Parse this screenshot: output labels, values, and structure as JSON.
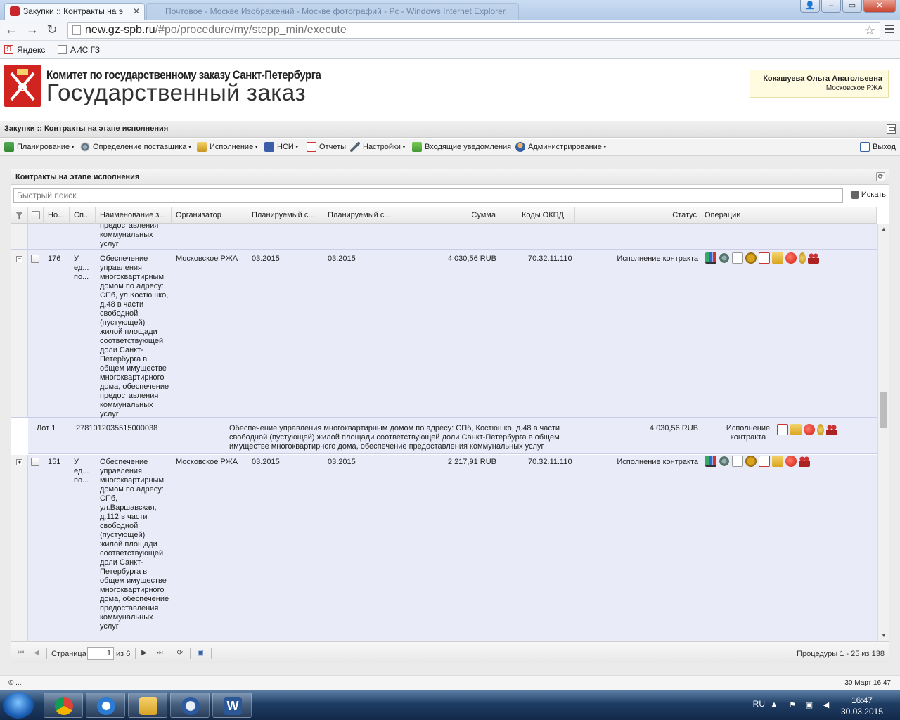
{
  "browser": {
    "active_tab": "Закупки :: Контракты на э",
    "inactive_tab": "Почтовое - Москве Изображений - Москве фотографий - Рс - Windows Internet Explorer",
    "url_host": "new.gz-spb.ru",
    "url_path": "/#po/procedure/my/stepp_min/execute",
    "bookmarks": [
      {
        "label": "Яндекс",
        "icon": "Я"
      },
      {
        "label": "АИС ГЗ",
        "icon": ""
      }
    ]
  },
  "header": {
    "org": "Комитет по государственному заказу Санкт-Петербурга",
    "site": "Государственный заказ",
    "user_name": "Кокашуева Ольга Анатольевна",
    "user_org": "Московское РЖА"
  },
  "section_title": "Закупки :: Контракты на этапе исполнения",
  "menu": {
    "planning": "Планирование",
    "supplier": "Определение поставщика",
    "execution": "Исполнение",
    "nsi": "НСИ",
    "reports": "Отчеты",
    "settings": "Настройки",
    "incoming": "Входящие уведомления",
    "admin": "Администрирование",
    "exit": "Выход"
  },
  "panel": {
    "title": "Контракты на этапе исполнения",
    "search_placeholder": "Быстрый поиск",
    "search_button": "Искать"
  },
  "columns": [
    "Но...",
    "Сп...",
    "Наименование з...",
    "Организатор",
    "Планируемый с...",
    "Планируемый с...",
    "Сумма",
    "Коды ОКПД",
    "Статус",
    "Операции"
  ],
  "partial_row": {
    "name_tail": "предоставления\nкоммунальных\nуслуг"
  },
  "rows": [
    {
      "num": "176",
      "method": "У\nед...\nпо...",
      "name": "Обеспечение\nуправления\nмногоквартирным\nдомом по адресу:\nСПб, ул.Костюшко,\nд.48 в части\nсвободной\n(пустующей)\nжилой площади\nсоответствующей\nдоли Санкт-\nПетербурга в\nобщем имуществе\nмногоквартирного\nдома, обеспечение\nпредоставления\nкоммунальных\nуслуг",
      "organizer": "Московское РЖА",
      "date1": "03.2015",
      "date2": "03.2015",
      "sum": "4 030,56 RUB",
      "okpd": "70.32.11.110",
      "status": "Исполнение контракта",
      "lot": {
        "label": "Лот 1",
        "code": "2781012035515000038",
        "name": "Обеспечение управления многоквартирным домом по адресу: СПб, Костюшко, д.48 в части\nсвободной (пустующей) жилой площади соответствующей доли Санкт-Петербурга в общем\nимуществе многоквартирного дома, обеспечение предоставления коммунальных услуг",
        "sum": "4 030,56 RUB",
        "status": "Исполнение\nконтракта"
      }
    },
    {
      "num": "151",
      "method": "У\nед...\nпо...",
      "name": "Обеспечение\nуправления\nмногоквартирным\nдомом по адресу:\nСПб,\nул.Варшавская,\nд.112 в части\nсвободной\n(пустующей)\nжилой площади\nсоответствующей\nдоли Санкт-\nПетербурга в\nобщем имуществе\nмногоквартирного\nдома, обеспечение\nпредоставления\nкоммунальных\nуслуг",
      "organizer": "Московское РЖА",
      "date1": "03.2015",
      "date2": "03.2015",
      "sum": "2 217,91 RUB",
      "okpd": "70.32.11.110",
      "status": "Исполнение контракта"
    }
  ],
  "pager": {
    "page_label": "Страница",
    "page_value": "1",
    "of_label": "из 6",
    "summary": "Процедуры 1 - 25 из 138"
  },
  "footer": {
    "left": "© ...",
    "right": "30 Март 16:47"
  },
  "taskbar": {
    "lang": "RU",
    "time": "16:47",
    "date": "30.03.2015"
  },
  "colors": {
    "row_bg": "#e9ebf8",
    "brand_red": "#d1231f"
  }
}
